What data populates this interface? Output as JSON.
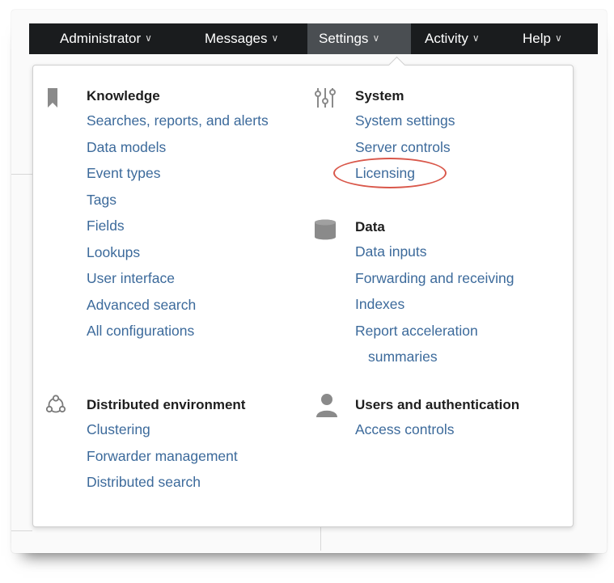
{
  "navbar": {
    "items": [
      {
        "label": "Administrator",
        "chevron": "∨"
      },
      {
        "label": "Messages",
        "chevron": "∨"
      },
      {
        "label": "Settings",
        "chevron": "∨"
      },
      {
        "label": "Activity",
        "chevron": "∨"
      },
      {
        "label": "Help",
        "chevron": "∨"
      }
    ]
  },
  "menu": {
    "knowledge": {
      "icon": "bookmark-icon",
      "heading": "Knowledge",
      "links": [
        "Searches, reports, and alerts",
        "Data models",
        "Event types",
        "Tags",
        "Fields",
        "Lookups",
        "User interface",
        "Advanced search",
        "All configurations"
      ]
    },
    "system": {
      "icon": "sliders-icon",
      "heading": "System",
      "links": [
        "System settings",
        "Server controls",
        "Licensing"
      ]
    },
    "data": {
      "icon": "database-icon",
      "heading": "Data",
      "links": [
        "Data inputs",
        "Forwarding and receiving",
        "Indexes",
        "Report acceleration",
        "summaries"
      ]
    },
    "distributed": {
      "icon": "distributed-icon",
      "heading": "Distributed environment",
      "links": [
        "Clustering",
        "Forwarder management",
        "Distributed search"
      ]
    },
    "users": {
      "icon": "user-icon",
      "heading": "Users and authentication",
      "links": [
        "Access controls"
      ]
    }
  },
  "colors": {
    "navbar_bg": "#1a1c1e",
    "navbar_active": "#4a4e52",
    "link": "#3c6a9b",
    "highlight_ring": "#d9574a"
  }
}
